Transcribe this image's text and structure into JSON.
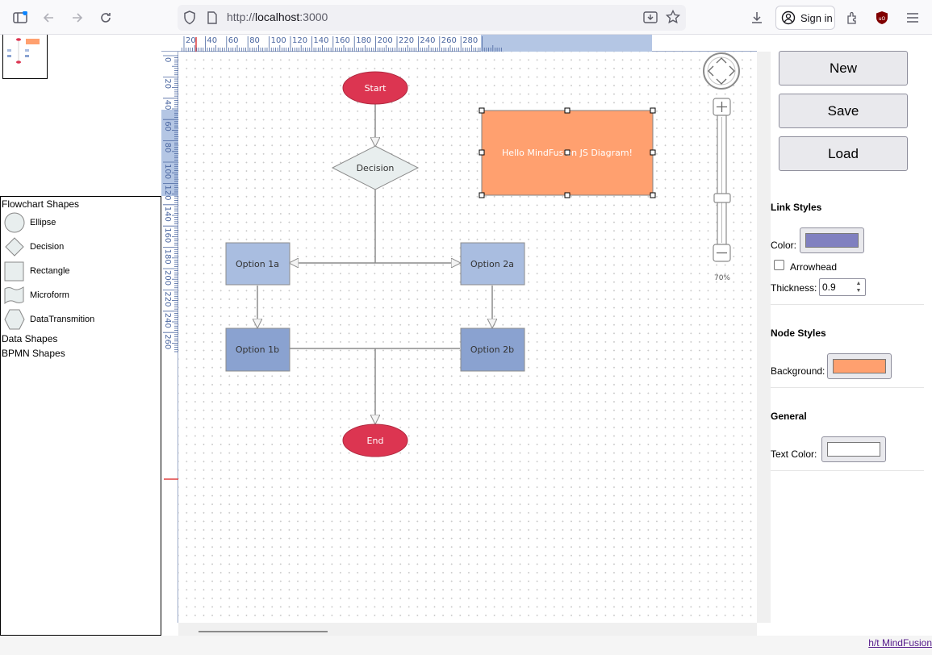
{
  "browser": {
    "url_prefix": "http://",
    "url_host": "localhost",
    "url_port": ":3000",
    "signin_label": "Sign in"
  },
  "palette": {
    "flowchart_title": "Flowchart Shapes",
    "items": [
      {
        "label": "Ellipse",
        "icon": "ellipse-shape-icon"
      },
      {
        "label": "Decision",
        "icon": "decision-shape-icon"
      },
      {
        "label": "Rectangle",
        "icon": "rectangle-shape-icon"
      },
      {
        "label": "Microform",
        "icon": "microform-shape-icon"
      },
      {
        "label": "DataTransmition",
        "icon": "datatransmition-shape-icon"
      }
    ],
    "data_title": "Data Shapes",
    "bpmn_title": "BPMN Shapes"
  },
  "ruler": {
    "top_labels": [
      "20",
      "40",
      "60",
      "80",
      "100",
      "120",
      "140",
      "160",
      "180",
      "200",
      "220",
      "240",
      "260",
      "280"
    ],
    "left_labels": [
      "0",
      "20",
      "40",
      "60",
      "80",
      "100",
      "120",
      "140",
      "160",
      "180",
      "200",
      "220",
      "240",
      "260"
    ]
  },
  "diagram": {
    "nodes": {
      "start": "Start",
      "decision": "Decision",
      "hello": "Hello MindFusion JS Diagram!",
      "option1a": "Option 1a",
      "option2a": "Option 2a",
      "option1b": "Option 1b",
      "option2b": "Option 2b",
      "end": "End"
    },
    "zoom_label": "70%",
    "colors": {
      "terminal": "#dc3551",
      "decision": "#e8eeee",
      "option_light": "#a9bde0",
      "option_dark": "#8aa2d0",
      "selected_node": "#ffa06f",
      "link": "#8c8c8c"
    }
  },
  "panel": {
    "new_label": "New",
    "save_label": "Save",
    "load_label": "Load",
    "link_styles_title": "Link Styles",
    "color_label": "Color:",
    "link_color": "#8080c0",
    "arrowhead_label": "Arrowhead",
    "thickness_label": "Thickness:",
    "thickness_value": "0.9",
    "node_styles_title": "Node Styles",
    "background_label": "Background:",
    "background_color": "#ffa06f",
    "general_title": "General",
    "text_color_label": "Text Color:",
    "text_color": "#ffffff"
  },
  "footer": {
    "credit": "h/t MindFusion"
  }
}
